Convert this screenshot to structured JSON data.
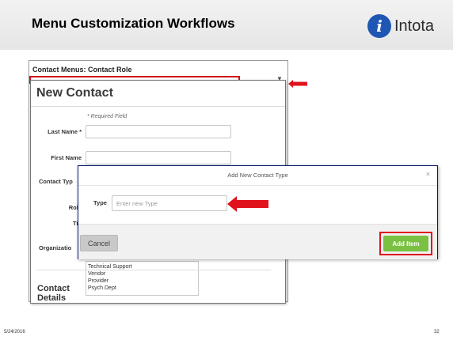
{
  "slide": {
    "title": "Menu Customization Workflows",
    "logo_glyph": "i",
    "logo_text": "Intota",
    "date": "5/24/2016",
    "page_number": "32"
  },
  "back_panel": {
    "title": "Contact Menus: Contact Role"
  },
  "new_contact": {
    "title": "New Contact",
    "required_note": "* Required Field",
    "fields": [
      {
        "label": "Last Name *"
      },
      {
        "label": "First Name"
      },
      {
        "label": "Contact Typ"
      },
      {
        "label": "Role"
      },
      {
        "label": "Titl"
      },
      {
        "label": "Organizatio"
      }
    ],
    "list_items": [
      "Technical Support",
      "Vendor",
      "Provider",
      "Psych Dept"
    ],
    "section_heading_line1": "Contact",
    "section_heading_line2": "Details"
  },
  "modal": {
    "title": "Add New Contact Type",
    "close_glyph": "×",
    "type_label": "Type",
    "type_placeholder": "Enter new Type",
    "type_value": "",
    "cancel_label": "Cancel",
    "add_label": "Add Item"
  },
  "colors": {
    "highlight_red": "#e0131c",
    "modal_border": "#0a1c73",
    "add_button": "#7ac142",
    "logo_blue": "#1f56b4"
  }
}
